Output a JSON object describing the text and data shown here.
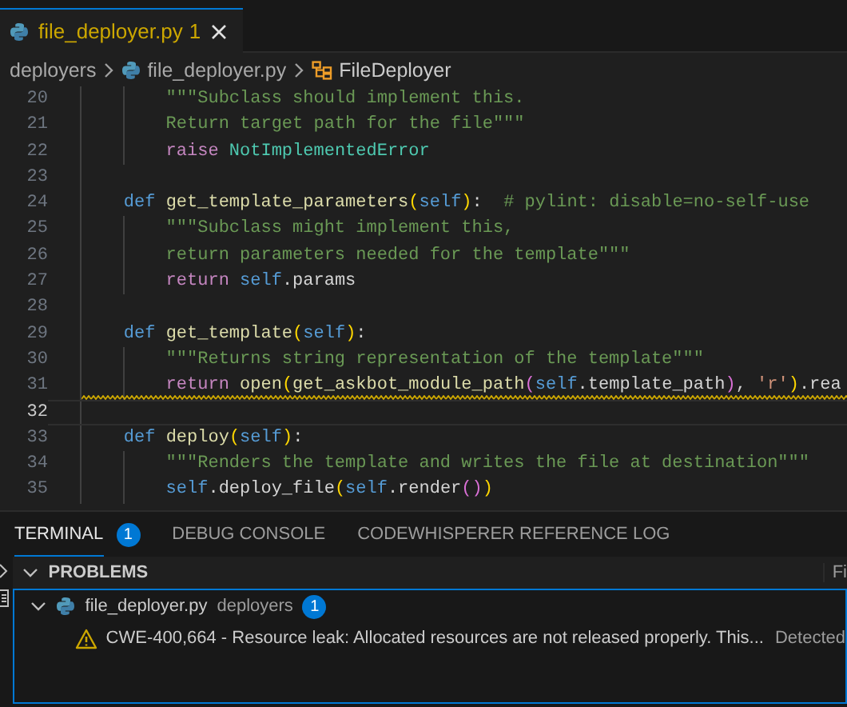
{
  "tab": {
    "filename": "file_deployer.py",
    "problem_count": "1",
    "selected": true
  },
  "breadcrumbs": [
    {
      "kind": "folder",
      "label": "deployers"
    },
    {
      "kind": "file",
      "label": "file_deployer.py"
    },
    {
      "kind": "class",
      "label": "FileDeployer"
    }
  ],
  "editor": {
    "lines": [
      {
        "number": "20",
        "current": false,
        "squiggle": false,
        "tokens": [
          {
            "kind": "docstring",
            "text": "        \"\"\"Subclass should implement this."
          }
        ]
      },
      {
        "number": "21",
        "current": false,
        "squiggle": false,
        "tokens": [
          {
            "kind": "docstring",
            "text": "        Return target path for the file\"\"\""
          }
        ]
      },
      {
        "number": "22",
        "current": false,
        "squiggle": false,
        "tokens": [
          {
            "kind": "control",
            "text": "        raise"
          },
          {
            "kind": "class",
            "text": " NotImplementedError"
          }
        ]
      },
      {
        "number": "23",
        "current": false,
        "squiggle": false
      },
      {
        "number": "24",
        "current": false,
        "squiggle": false,
        "tokens": [
          {
            "kind": "keyword",
            "text": "    def"
          },
          {
            "kind": "function",
            "text": " get_template_parameters"
          },
          {
            "kind": "bracket1",
            "text": "("
          },
          {
            "kind": "self",
            "text": "self"
          },
          {
            "kind": "bracket1",
            "text": ")"
          },
          {
            "kind": "plain",
            "text": ":"
          },
          {
            "kind": "comment",
            "text": "  # pylint: disable=no-self-use"
          }
        ]
      },
      {
        "number": "25",
        "current": false,
        "squiggle": false,
        "tokens": [
          {
            "kind": "docstring",
            "text": "        \"\"\"Subclass might implement this,"
          }
        ]
      },
      {
        "number": "26",
        "current": false,
        "squiggle": false,
        "tokens": [
          {
            "kind": "docstring",
            "text": "        return parameters needed for the template\"\"\""
          }
        ]
      },
      {
        "number": "27",
        "current": false,
        "squiggle": false,
        "tokens": [
          {
            "kind": "control",
            "text": "        return"
          },
          {
            "kind": "self",
            "text": " self"
          },
          {
            "kind": "plain",
            "text": ".params"
          }
        ]
      },
      {
        "number": "28",
        "current": false,
        "squiggle": false
      },
      {
        "number": "29",
        "current": false,
        "squiggle": false,
        "tokens": [
          {
            "kind": "keyword",
            "text": "    def"
          },
          {
            "kind": "function",
            "text": " get_template"
          },
          {
            "kind": "bracket1",
            "text": "("
          },
          {
            "kind": "self",
            "text": "self"
          },
          {
            "kind": "bracket1",
            "text": ")"
          },
          {
            "kind": "plain",
            "text": ":"
          }
        ]
      },
      {
        "number": "30",
        "current": false,
        "squiggle": false,
        "tokens": [
          {
            "kind": "docstring",
            "text": "        \"\"\"Returns string representation of the template\"\"\""
          }
        ]
      },
      {
        "number": "31",
        "current": false,
        "squiggle": true,
        "tokens": [
          {
            "kind": "control",
            "text": "        return"
          },
          {
            "kind": "function",
            "text": " open"
          },
          {
            "kind": "bracket1",
            "text": "("
          },
          {
            "kind": "function",
            "text": "get_askbot_module_path"
          },
          {
            "kind": "bracket2",
            "text": "("
          },
          {
            "kind": "self",
            "text": "self"
          },
          {
            "kind": "plain",
            "text": ".template_path"
          },
          {
            "kind": "bracket2",
            "text": ")"
          },
          {
            "kind": "plain",
            "text": ","
          },
          {
            "kind": "string",
            "text": " 'r'"
          },
          {
            "kind": "bracket1",
            "text": ")"
          },
          {
            "kind": "plain",
            "text": ".rea"
          }
        ]
      },
      {
        "number": "32",
        "current": true,
        "squiggle": false
      },
      {
        "number": "33",
        "current": false,
        "squiggle": false,
        "tokens": [
          {
            "kind": "keyword",
            "text": "    def"
          },
          {
            "kind": "function",
            "text": " deploy"
          },
          {
            "kind": "bracket1",
            "text": "("
          },
          {
            "kind": "self",
            "text": "self"
          },
          {
            "kind": "bracket1",
            "text": ")"
          },
          {
            "kind": "plain",
            "text": ":"
          }
        ]
      },
      {
        "number": "34",
        "current": false,
        "squiggle": false,
        "tokens": [
          {
            "kind": "docstring",
            "text": "        \"\"\"Renders the template and writes the file at destination\"\"\""
          }
        ]
      },
      {
        "number": "35",
        "current": false,
        "squiggle": false,
        "tokens": [
          {
            "kind": "self",
            "text": "        self"
          },
          {
            "kind": "plain",
            "text": ".deploy_file"
          },
          {
            "kind": "bracket1",
            "text": "("
          },
          {
            "kind": "self",
            "text": "self"
          },
          {
            "kind": "plain",
            "text": ".render"
          },
          {
            "kind": "bracket2",
            "text": "()"
          },
          {
            "kind": "bracket1",
            "text": ")"
          }
        ]
      }
    ]
  },
  "panel": {
    "tabs": [
      {
        "label": "TERMINAL",
        "badge": "1",
        "selected": true
      },
      {
        "label": "DEBUG CONSOLE",
        "selected": false
      },
      {
        "label": "CODEWHISPERER REFERENCE LOG",
        "selected": false
      }
    ],
    "section": {
      "title": "PROBLEMS",
      "expanded": true,
      "action": "Fi"
    },
    "problems": [
      {
        "file": "file_deployer.py",
        "folder": "deployers",
        "count": "1",
        "expanded": true,
        "children": [
          {
            "message": "CWE-400,664 - Resource leak: Allocated resources are not released properly. This...",
            "source": "Detected"
          }
        ]
      }
    ]
  }
}
